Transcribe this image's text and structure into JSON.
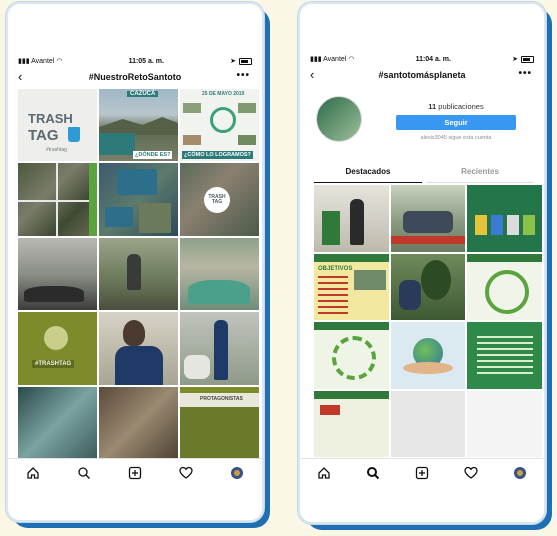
{
  "left_phone": {
    "status": {
      "carrier": "Avantel",
      "time": "11:05 a. m."
    },
    "title": "#NuestroRetoSantoto",
    "tiles": {
      "trash_tag_line1": "TRASH",
      "trash_tag_line2": "TAG",
      "trash_tag_hashtag": "#trashtag",
      "cazuca": "CAZUCÁ",
      "date": "25 DE MAYO 2019",
      "donde": "¿DÓNDE ES?",
      "como": "¿CÓMO LO LOGRAMOS?",
      "trash_tag_small": "TRASH TAG",
      "hashtag_tile": "#TRASHTAG",
      "protagonistas": "PROTAGONISTAS"
    }
  },
  "right_phone": {
    "status": {
      "carrier": "Avantel",
      "time": "11:04 a. m."
    },
    "title": "#santotomásplaneta",
    "profile": {
      "posts_count": "11",
      "posts_label": "publicaciones",
      "follow_label": "Seguir",
      "followed_by": "alexis3045 sigue esta cuenta"
    },
    "tabs": {
      "featured": "Destacados",
      "recent": "Recientes"
    },
    "tiles": {
      "objetivos": "OBJETIVOS"
    }
  },
  "colors": {
    "frame_blue": "#1f6fb4",
    "background": "#fbf7e6",
    "follow_button": "#3897f0",
    "olive": "#7d8b2b",
    "teal": "#2d7a7a"
  }
}
